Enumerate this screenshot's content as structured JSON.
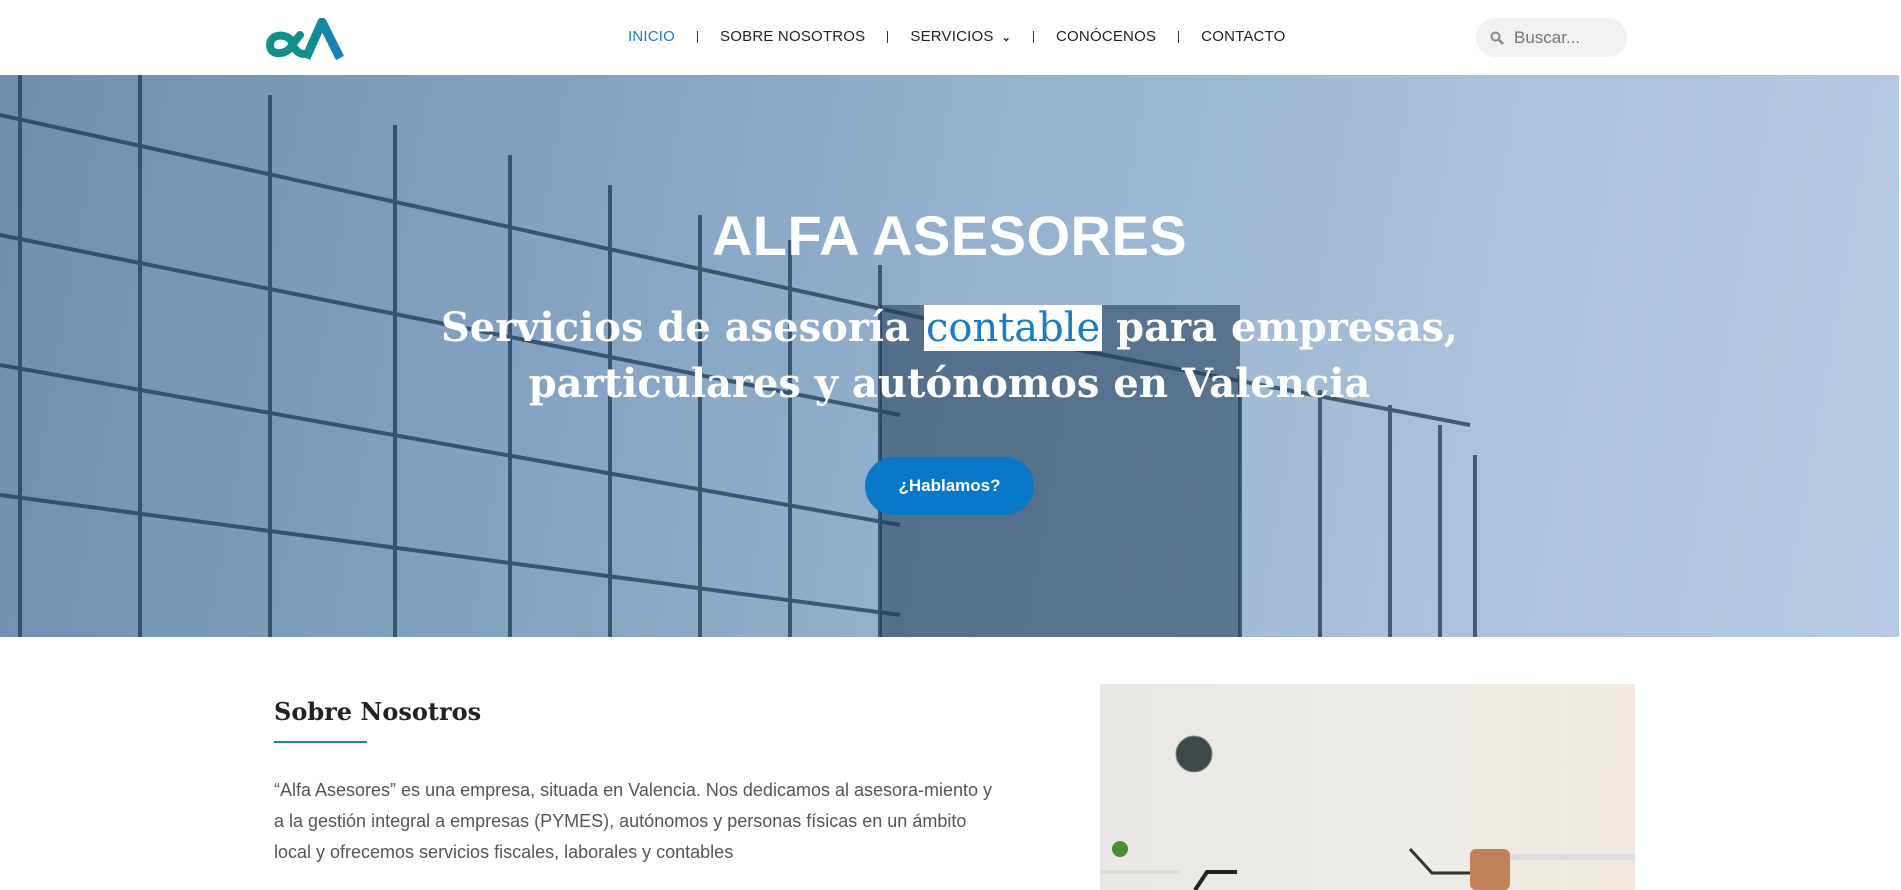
{
  "header": {
    "logo_alt": "αΛ",
    "nav": [
      {
        "label": "INICIO",
        "active": true
      },
      {
        "label": "SOBRE NOSOTROS"
      },
      {
        "label": "SERVICIOS"
      },
      {
        "label": "CONÓCENOS"
      },
      {
        "label": "CONTACTO"
      }
    ],
    "search_placeholder": "Buscar..."
  },
  "hero": {
    "title": "ALFA ASESORES",
    "subtitle_pre": "Servicios de asesoría ",
    "subtitle_highlight": "contable",
    "subtitle_post": " para empresas,",
    "subtitle_line2": "particulares y autónomos en Valencia",
    "cta_label": "¿Hablamos?"
  },
  "about": {
    "title": "Sobre Nosotros",
    "text": "“Alfa Asesores” es una empresa, situada en Valencia. Nos dedicamos al asesora-miento y a la gestión integral a empresas (PYMES), autónomos y personas físicas en un ámbito local y ofrecemos servicios fiscales, laborales y contables"
  },
  "colors": {
    "accent": "#1a7cc1",
    "button": "#0a78c8",
    "logo_teal": "#18a39a"
  }
}
